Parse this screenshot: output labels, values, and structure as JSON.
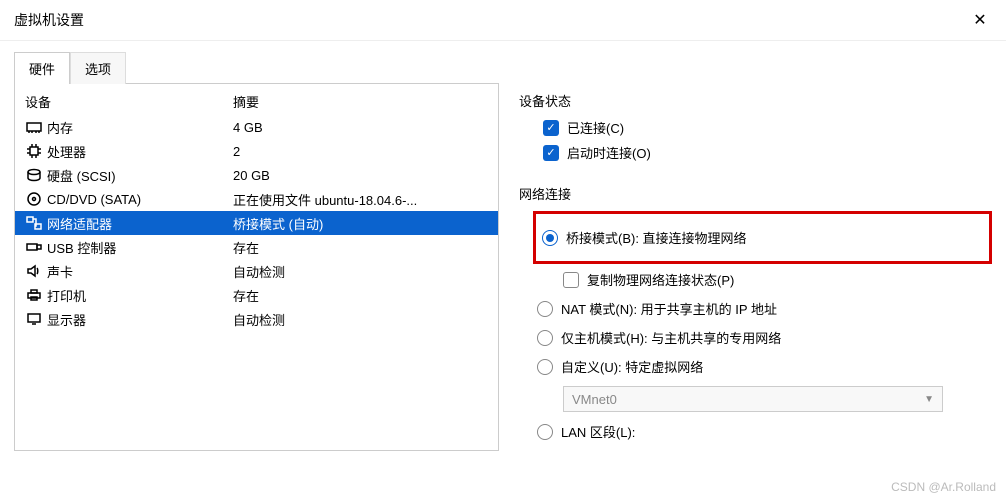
{
  "window": {
    "title": "虚拟机设置"
  },
  "tabs": {
    "hardware": "硬件",
    "options": "选项"
  },
  "headers": {
    "device": "设备",
    "summary": "摘要"
  },
  "devices": [
    {
      "icon": "memory",
      "name": "内存",
      "summary": "4 GB"
    },
    {
      "icon": "cpu",
      "name": "处理器",
      "summary": "2"
    },
    {
      "icon": "disk",
      "name": "硬盘 (SCSI)",
      "summary": "20 GB"
    },
    {
      "icon": "disc",
      "name": "CD/DVD (SATA)",
      "summary": "正在使用文件 ubuntu-18.04.6-..."
    },
    {
      "icon": "net",
      "name": "网络适配器",
      "summary": "桥接模式 (自动)",
      "selected": true
    },
    {
      "icon": "usb",
      "name": "USB 控制器",
      "summary": "存在"
    },
    {
      "icon": "sound",
      "name": "声卡",
      "summary": "自动检测"
    },
    {
      "icon": "printer",
      "name": "打印机",
      "summary": "存在"
    },
    {
      "icon": "display",
      "name": "显示器",
      "summary": "自动检测"
    }
  ],
  "right": {
    "state_label": "设备状态",
    "connected": "已连接(C)",
    "connect_on_start": "启动时连接(O)",
    "net_label": "网络连接",
    "bridge": "桥接模式(B): 直接连接物理网络",
    "replicate": "复制物理网络连接状态(P)",
    "nat": "NAT 模式(N): 用于共享主机的 IP 地址",
    "hostonly": "仅主机模式(H): 与主机共享的专用网络",
    "custom": "自定义(U): 特定虚拟网络",
    "vmnet": "VMnet0",
    "lanseg": "LAN 区段(L):"
  },
  "watermark": "CSDN @Ar.Rolland"
}
